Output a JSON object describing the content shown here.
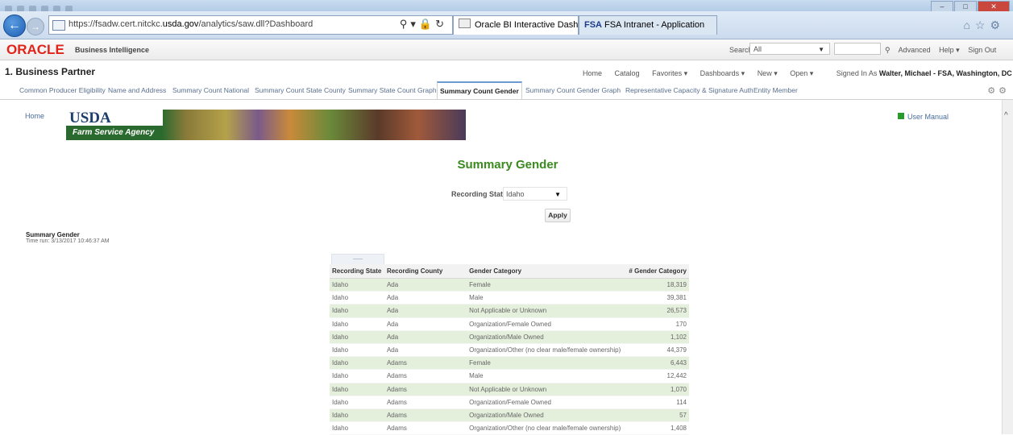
{
  "browser": {
    "url_prefix": "https://fsadw.cert.nitckc.",
    "url_domain": "usda.gov",
    "url_path": "/analytics/saw.dll?Dashboard",
    "tabs": [
      {
        "label": "Oracle BI Interactive Dashb...",
        "active": true
      },
      {
        "label": "FSA Intranet - Application",
        "active": false
      }
    ],
    "tab2_prefix": "FSA"
  },
  "header": {
    "brand": "ORACLE",
    "product": "Business Intelligence",
    "search_label": "Search",
    "search_scope": "All",
    "links": [
      "Advanced",
      "Help ▾",
      "Sign Out"
    ]
  },
  "dashboard": {
    "title": "1. Business Partner",
    "menu": [
      "Home",
      "Catalog",
      "Favorites ▾",
      "Dashboards ▾",
      "New ▾",
      "Open ▾"
    ],
    "signed_in_label": "Signed In As",
    "signed_in_user": "Walter, Michael - FSA, Washington, DC ▾",
    "pages": [
      "Common Producer Eligibility",
      "Name and Address",
      "Summary Count National",
      "Summary Count State County",
      "Summary State Count Graph",
      "Summary Count Gender",
      "Summary Count Gender Graph",
      "Representative Capacity & Signature Auth",
      "Entity Member"
    ],
    "active_page": "Summary Count Gender"
  },
  "content": {
    "home_link": "Home",
    "manual_link": "User Manual",
    "banner_usda": "USDA",
    "banner_agency": "Farm Service Agency",
    "section_title": "Summary Gender",
    "prompt_label": "Recording State",
    "prompt_value": "Idaho",
    "apply_label": "Apply",
    "report_title": "Summary Gender",
    "report_time": "Time run: 3/13/2017 10:46:37 AM"
  },
  "table": {
    "columns": [
      "Recording State",
      "Recording County",
      "Gender Category",
      "# Gender Category"
    ],
    "rows": [
      [
        "Idaho",
        "Ada",
        "Female",
        "18,319"
      ],
      [
        "Idaho",
        "Ada",
        "Male",
        "39,381"
      ],
      [
        "Idaho",
        "Ada",
        "Not Applicable or Unknown",
        "26,573"
      ],
      [
        "Idaho",
        "Ada",
        "Organization/Female Owned",
        "170"
      ],
      [
        "Idaho",
        "Ada",
        "Organization/Male Owned",
        "1,102"
      ],
      [
        "Idaho",
        "Ada",
        "Organization/Other (no clear male/female ownership)",
        "44,379"
      ],
      [
        "Idaho",
        "Adams",
        "Female",
        "6,443"
      ],
      [
        "Idaho",
        "Adams",
        "Male",
        "12,442"
      ],
      [
        "Idaho",
        "Adams",
        "Not Applicable or Unknown",
        "1,070"
      ],
      [
        "Idaho",
        "Adams",
        "Organization/Female Owned",
        "114"
      ],
      [
        "Idaho",
        "Adams",
        "Organization/Male Owned",
        "57"
      ],
      [
        "Idaho",
        "Adams",
        "Organization/Other (no clear male/female ownership)",
        "1,408"
      ]
    ]
  },
  "colors": {
    "oracle_red": "#e2231a",
    "title_green": "#3a8a1f",
    "row_band": "#e4efdc",
    "link_blue": "#4a6c9b"
  }
}
